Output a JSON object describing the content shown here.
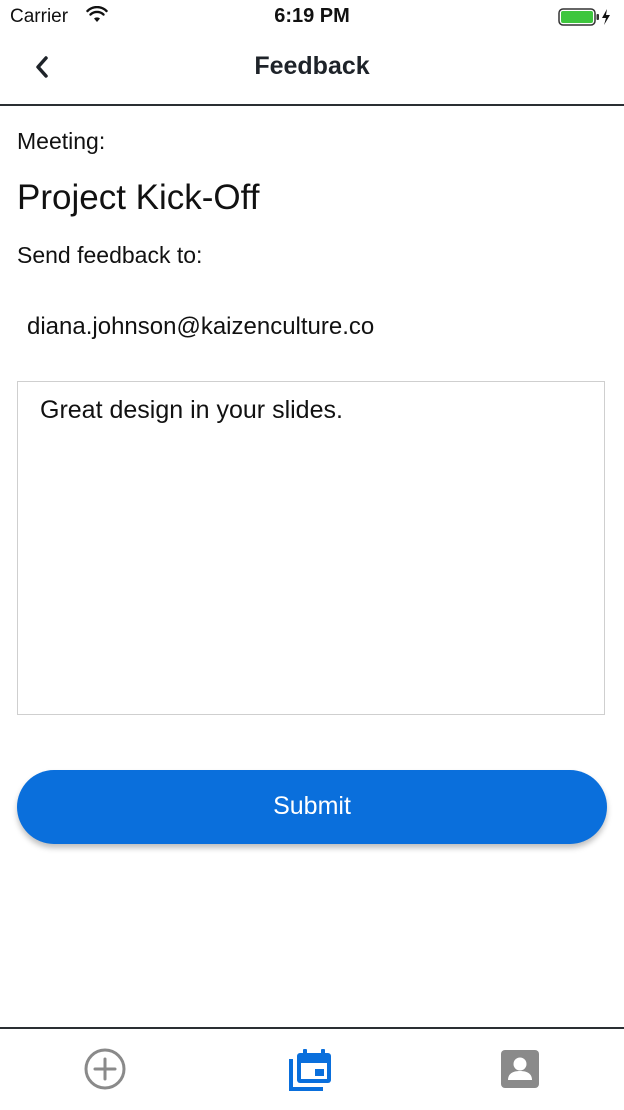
{
  "status_bar": {
    "carrier": "Carrier",
    "time": "6:19 PM",
    "icons": [
      "wifi-icon",
      "battery-icon"
    ]
  },
  "nav": {
    "title": "Feedback",
    "back_icon": "chevron-left-icon"
  },
  "form": {
    "meeting_label": "Meeting:",
    "meeting_title": "Project Kick-Off",
    "send_label": "Send feedback to:",
    "recipient_email": "diana.johnson@kaizenculture.co",
    "feedback_value": "Great design in your slides.",
    "submit_label": "Submit"
  },
  "tab_bar": {
    "tabs": [
      {
        "icon": "add-circle-icon",
        "active": false
      },
      {
        "icon": "calendar-icon",
        "active": true
      },
      {
        "icon": "profile-icon",
        "active": false
      }
    ]
  },
  "colors": {
    "accent": "#0a6fdc",
    "inactive_tab": "#8a8a8a",
    "divider": "#2a2f33"
  }
}
